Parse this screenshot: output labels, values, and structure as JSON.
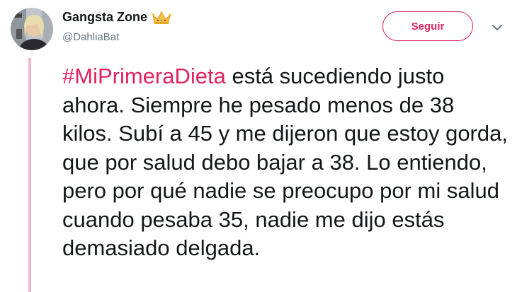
{
  "author": {
    "display_name": "Gangsta Zone",
    "username": "@DahliaBat",
    "badge_icon": "crown-icon"
  },
  "actions": {
    "follow_label": "Seguir",
    "menu_icon": "chevron-down-icon"
  },
  "tweet": {
    "hashtag": "#MiPrimeraDieta",
    "body": " está sucediendo justo ahora. Siempre he pesado menos de 38 kilos. Subí a 45 y me dijeron que estoy gorda, que por salud debo bajar a 38. Lo entiendo, pero por qué nadie se preocupo por mi salud cuando pesaba 35, nadie me dijo estás demasiado delgada."
  },
  "colors": {
    "accent": "#e0245e",
    "text": "#14171a",
    "muted": "#657786",
    "thread_line": "#f0b8c8"
  }
}
